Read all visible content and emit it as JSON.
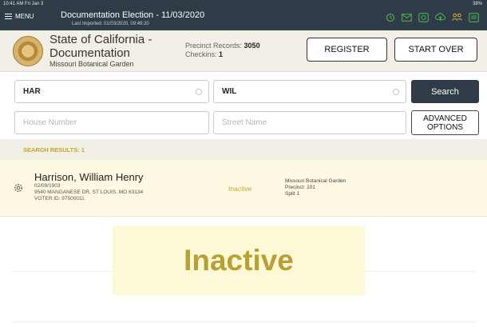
{
  "status": {
    "time": "10:41 AM  Fri Jan 3",
    "battery": "38%"
  },
  "topbar": {
    "menu_label": "MENU",
    "title": "Documentation Election - 11/03/2020",
    "subtitle": "Last Imported: 01/03/2020, 09:49:20",
    "icons": [
      "history-icon",
      "mail-icon",
      "sync-icon",
      "upload-icon",
      "users-icon",
      "tablet-icon"
    ]
  },
  "header": {
    "org_line1": "State of California -",
    "org_line2": "Documentation",
    "location": "Missouri Botanical Garden",
    "records_label": "Precinct Records:",
    "records_value": "3050",
    "checkins_label": "Checkins:",
    "checkins_value": "1",
    "register_label": "REGISTER",
    "start_over_label": "START OVER"
  },
  "search": {
    "last_name_value": "HAR",
    "first_name_value": "WIL",
    "house_placeholder": "House Number",
    "street_placeholder": "Street Name",
    "search_label": "Search",
    "advanced_line1": "ADVANCED",
    "advanced_line2": "OPTIONS"
  },
  "results": {
    "label": "SEARCH RESULTS: 1",
    "rows": [
      {
        "name": "Harrison, William Henry",
        "dob": "02/09/1903",
        "address": "9540 MANGANESE DR, ST LOUIS, MO 63134",
        "voter_id": "VOTER ID: 97500011",
        "status": "Inactive",
        "polling_place": "Missouri Botanical Garden",
        "precinct": "Precinct: 101",
        "split": "Split 1"
      }
    ]
  },
  "overlay_text": "Inactive",
  "colors": {
    "topbar": "#2f3b46",
    "accent_gold": "#c9a227",
    "header_bg": "#f2efe6",
    "row_bg": "#fdf9e2",
    "icon_green": "#4caf50"
  }
}
